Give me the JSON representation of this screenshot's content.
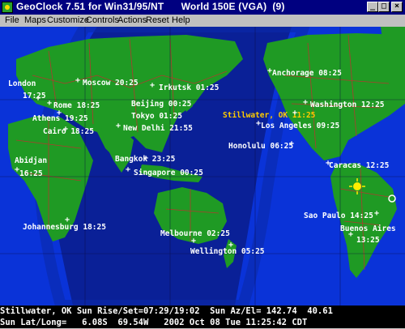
{
  "window": {
    "title": "GeoClock 7.51 for Win31/95/NT      World 150E (VGA)  (9)",
    "minimize_glyph": "_",
    "maximize_glyph": "□",
    "close_glyph": "×"
  },
  "menu": {
    "items": [
      "File",
      "Maps",
      "Customize",
      "Controls",
      "Actions",
      "Reset",
      "Help"
    ]
  },
  "map": {
    "cities": [
      {
        "label": "London",
        "highlight": false
      },
      {
        "label": "17:25",
        "highlight": false
      },
      {
        "label": "Moscow 20:25",
        "highlight": false
      },
      {
        "label": "Irkutsk 01:25",
        "highlight": false
      },
      {
        "label": "Anchorage 08:25",
        "highlight": false
      },
      {
        "label": "Rome 18:25",
        "highlight": false
      },
      {
        "label": "Beijing 00:25",
        "highlight": false
      },
      {
        "label": "Washington 12:25",
        "highlight": false
      },
      {
        "label": "Athens 19:25",
        "highlight": false
      },
      {
        "label": "Tokyo 01:25",
        "highlight": false
      },
      {
        "label": "Stillwater, OK 11:25",
        "highlight": true
      },
      {
        "label": "Cairo 18:25",
        "highlight": false
      },
      {
        "label": "New Delhi 21:55",
        "highlight": false
      },
      {
        "label": "Los Angeles 09:25",
        "highlight": false
      },
      {
        "label": "Honolulu 06:25",
        "highlight": false
      },
      {
        "label": "Abidjan",
        "highlight": false
      },
      {
        "label": "16:25",
        "highlight": false
      },
      {
        "label": "Bangkok 23:25",
        "highlight": false
      },
      {
        "label": "Singapore 00:25",
        "highlight": false
      },
      {
        "label": "Caracas 12:25",
        "highlight": false
      },
      {
        "label": "Johannesburg 18:25",
        "highlight": false
      },
      {
        "label": "Sao Paulo 14:25",
        "highlight": false
      },
      {
        "label": "Buenos Aires",
        "highlight": false
      },
      {
        "label": "13:25",
        "highlight": false
      },
      {
        "label": "Melbourne 02:25",
        "highlight": false
      },
      {
        "label": "Wellington 05:25",
        "highlight": false
      }
    ],
    "colors": {
      "ocean_day": "#0a33d8",
      "ocean_night": "#0a1f8a",
      "land": "#1f9a24",
      "borders": "#c03030",
      "label": "#ffffff",
      "home_label": "#ffcc00",
      "sun": "#ffee00"
    }
  },
  "status": {
    "line1": "Stillwater, OK Sun Rise/Set=07:29/19:02  Sun Az/El= 142.74  40.61",
    "line2": "Sun Lat/Long=   6.08S  69.54W   2002 Oct 08 Tue 11:25:42 CDT"
  }
}
